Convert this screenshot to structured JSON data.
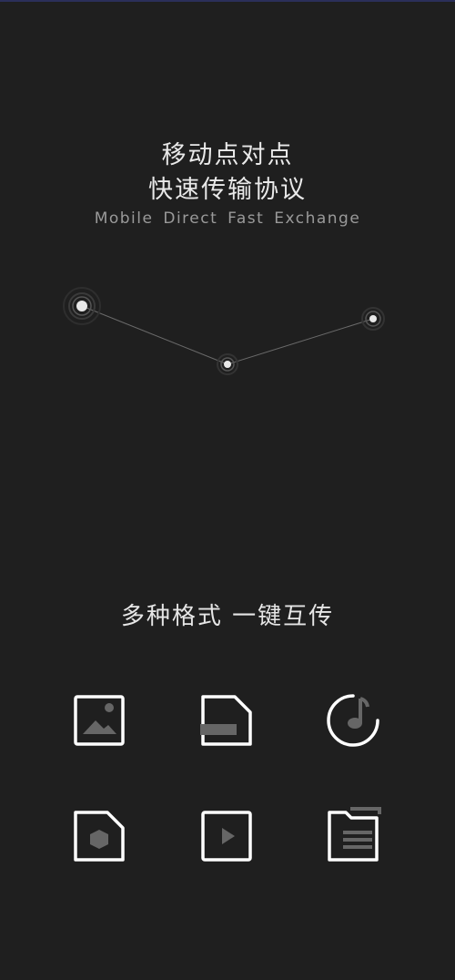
{
  "hero": {
    "title_line1": "移动点对点",
    "title_line2": "快速传输协议",
    "subtitle": "Mobile Direct Fast Exchange"
  },
  "formats": {
    "title": "多种格式 一键互传",
    "icons": [
      "image-file-icon",
      "document-file-icon",
      "music-icon",
      "package-file-icon",
      "video-play-icon",
      "folder-list-icon"
    ]
  },
  "colors": {
    "background": "#1f1f1f",
    "icon_stroke": "#ffffff",
    "icon_fill": "#666666",
    "subtitle": "#9a9a9a"
  }
}
